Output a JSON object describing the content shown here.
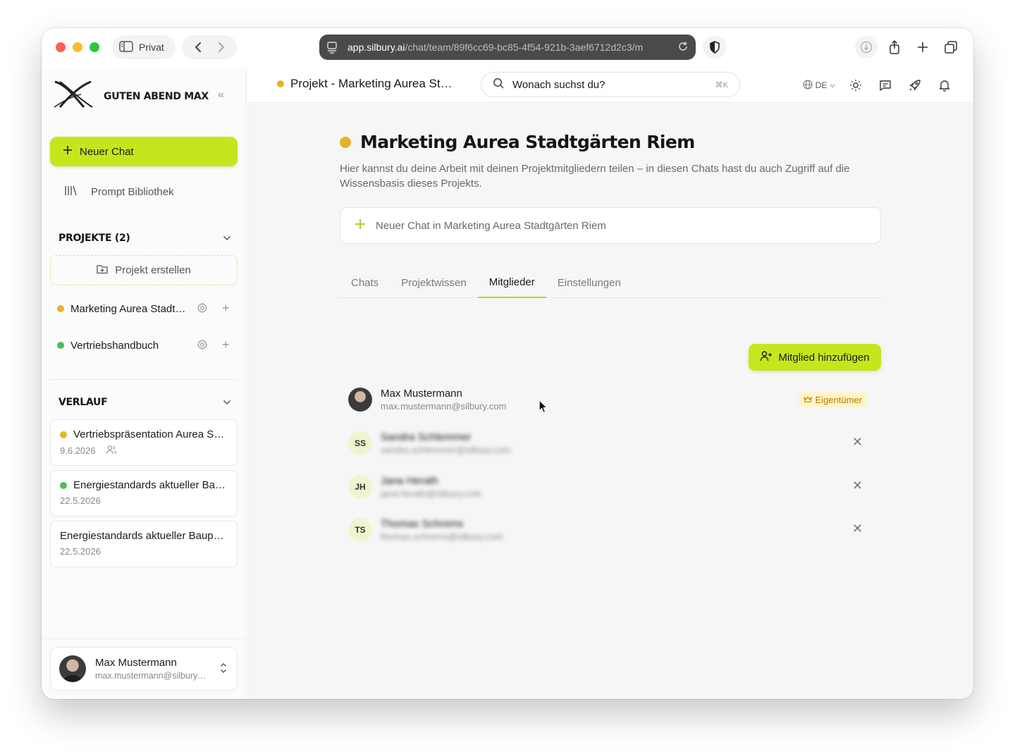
{
  "browser": {
    "profile_label": "Privat",
    "url_main": "app.silbury.ai",
    "url_path": "/chat/team/89f6cc69-bc85-4f54-921b-3aef6712d2c3/m"
  },
  "sidebar": {
    "brand_title": "GUTEN ABEND MAX",
    "new_chat_label": "Neuer Chat",
    "prompt_library_label": "Prompt Bibliothek",
    "projects_heading": "PROJEKTE (2)",
    "create_project_label": "Projekt erstellen",
    "projects": [
      {
        "name": "Marketing Aurea Stadtgärten Riem",
        "color": "#e6b325"
      },
      {
        "name": "Vertriebshandbuch",
        "color": "#4cbf5a"
      }
    ],
    "history_heading": "VERLAUF",
    "history": [
      {
        "title": "Vertriebspräsentation Aurea Stadtgärten",
        "date": "9.6.2026",
        "color": "#e6b325",
        "shared": true
      },
      {
        "title": "Energiestandards aktueller Bauprojekte",
        "date": "22.5.2026",
        "color": "#4cbf5a",
        "shared": false
      },
      {
        "title": "Energiestandards aktueller Bauprojekte",
        "date": "22.5.2026",
        "color": "",
        "shared": false
      }
    ],
    "user": {
      "name": "Max Mustermann",
      "email": "max.mustermann@silbury.com"
    }
  },
  "header": {
    "breadcrumb": "Projekt - Marketing Aurea Stadtgärten Riem",
    "search_placeholder": "Wonach suchst du?",
    "search_shortcut": "⌘K",
    "language": "DE"
  },
  "main": {
    "project_title": "Marketing Aurea Stadtgärten Riem",
    "project_color": "#e6b325",
    "description": "Hier kannst du deine Arbeit mit deinen Projektmitgliedern teilen – in diesen Chats hast du auch Zugriff auf die Wissensbasis dieses Projekts.",
    "new_chat_placeholder": "Neuer Chat in Marketing Aurea Stadtgärten Riem",
    "tabs": [
      "Chats",
      "Projektwissen",
      "Mitglieder",
      "Einstellungen"
    ],
    "active_tab": "Mitglieder",
    "add_member_label": "Mitglied hinzufügen",
    "members": [
      {
        "initials": "",
        "name": "Max Mustermann",
        "email": "max.mustermann@silbury.com",
        "badge": "Eigentümer"
      },
      {
        "initials": "SS",
        "name": "Sandra Schlemmer",
        "email": "sandra.schlemmer@silbury.com"
      },
      {
        "initials": "JH",
        "name": "Jana Herath",
        "email": "jana.herath@silbury.com"
      },
      {
        "initials": "TS",
        "name": "Thomas Schrems",
        "email": "thomas.schrems@silbury.com"
      }
    ]
  },
  "colors": {
    "accent": "#c5e61d",
    "project_yellow": "#e6b325",
    "project_green": "#4cbf5a"
  }
}
